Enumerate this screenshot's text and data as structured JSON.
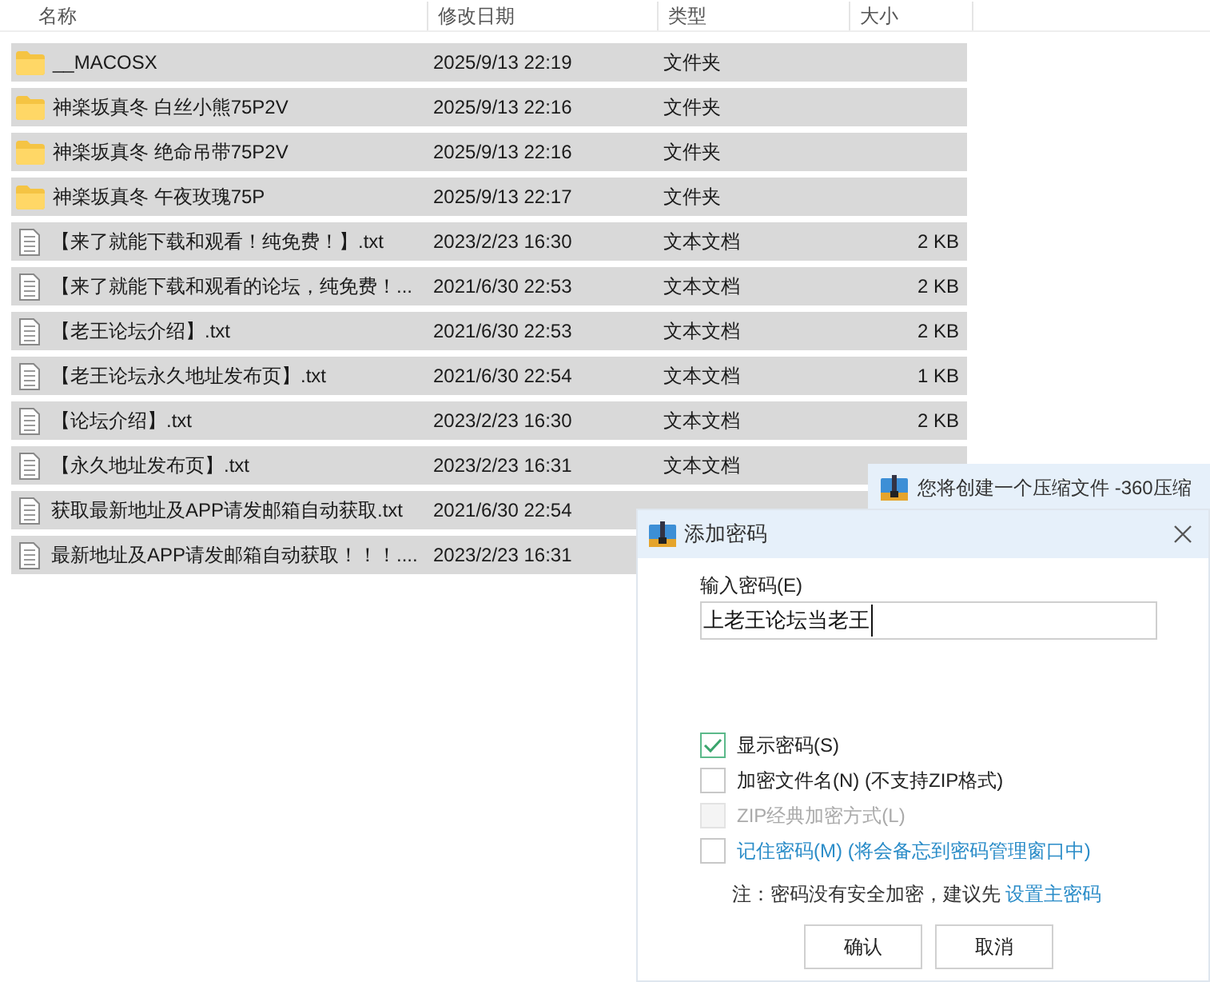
{
  "columns": [
    "名称",
    "修改日期",
    "类型",
    "大小"
  ],
  "rows": [
    {
      "kind": "folder",
      "name": "__MACOSX",
      "date": "2025/9/13 22:19",
      "type": "文件夹",
      "selected": true
    },
    {
      "kind": "folder",
      "name": "神楽坂真冬 白丝小熊75P2V",
      "date": "2025/9/13 22:16",
      "type": "文件夹",
      "selected": true
    },
    {
      "kind": "folder",
      "name": "神楽坂真冬 绝命吊带75P2V",
      "date": "2025/9/13 22:16",
      "type": "文件夹",
      "selected": true
    },
    {
      "kind": "folder",
      "name": "神楽坂真冬 午夜玫瑰75P",
      "date": "2025/9/13 22:17",
      "type": "文件夹",
      "selected": true
    },
    {
      "kind": "text",
      "name": "【来了就能下载和观看！纯免费！】.txt",
      "date": "2023/2/23 16:30",
      "type": "文本文档",
      "size": "2 KB",
      "selected": true
    },
    {
      "kind": "text",
      "name": "【来了就能下载和观看的论坛，纯免费！...",
      "date": "2021/6/30 22:53",
      "type": "文本文档",
      "size": "2 KB",
      "selected": true
    },
    {
      "kind": "text",
      "name": "【老王论坛介绍】.txt",
      "date": "2021/6/30 22:53",
      "type": "文本文档",
      "size": "2 KB",
      "selected": true
    },
    {
      "kind": "text",
      "name": "【老王论坛永久地址发布页】.txt",
      "date": "2021/6/30 22:54",
      "type": "文本文档",
      "size": "1 KB",
      "selected": true
    },
    {
      "kind": "text",
      "name": "【论坛介绍】.txt",
      "date": "2023/2/23 16:30",
      "type": "文本文档",
      "size": "2 KB",
      "selected": true
    },
    {
      "kind": "text",
      "name": "【永久地址发布页】.txt",
      "date": "2023/2/23 16:31",
      "type": "文本文档",
      "selected": true
    },
    {
      "kind": "text",
      "name": "获取最新地址及APP请发邮箱自动获取.txt",
      "date": "2021/6/30 22:54",
      "selected": true
    },
    {
      "kind": "text",
      "name": "最新地址及APP请发邮箱自动获取！！！....",
      "date": "2023/2/23 16:31",
      "selected": true
    }
  ],
  "back_window": {
    "title": "您将创建一个压缩文件 -360压缩"
  },
  "dialog": {
    "title": "添加密码",
    "password_label": "输入密码(E)",
    "password_value": "上老王论坛当老王",
    "options": [
      {
        "kind": "plain",
        "label": "显示密码(S)",
        "checked": true,
        "disabled": false
      },
      {
        "kind": "plain",
        "label": "加密文件名(N) (不支持ZIP格式)",
        "checked": false,
        "disabled": false
      },
      {
        "kind": "plain",
        "label": "ZIP经典加密方式(L)",
        "checked": false,
        "disabled": true
      },
      {
        "kind": "link",
        "label": "记住密码(M) (将会备忘到密码管理窗口中)",
        "checked": false,
        "disabled": false
      }
    ],
    "note": "注：密码没有安全加密，建议先",
    "note_link": "设置主密码",
    "buttons": [
      "确认",
      "取消"
    ]
  }
}
